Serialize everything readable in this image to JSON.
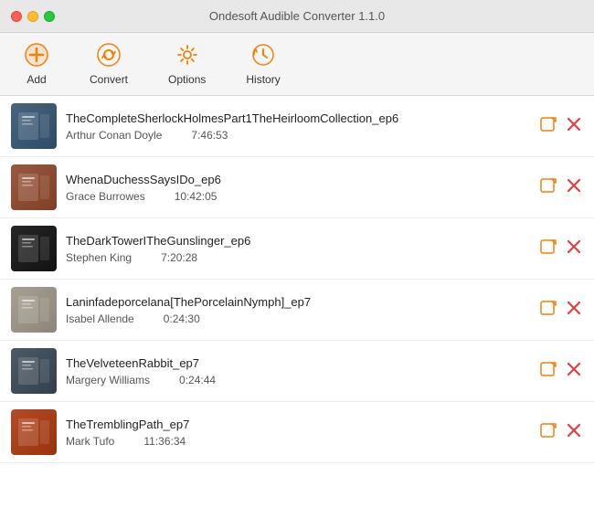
{
  "titleBar": {
    "title": "Ondesoft Audible Converter 1.1.0"
  },
  "toolbar": {
    "items": [
      {
        "id": "add",
        "label": "Add",
        "icon": "add"
      },
      {
        "id": "convert",
        "label": "Convert",
        "icon": "convert"
      },
      {
        "id": "options",
        "label": "Options",
        "icon": "options"
      },
      {
        "id": "history",
        "label": "History",
        "icon": "history"
      }
    ]
  },
  "books": [
    {
      "id": 1,
      "title": "TheCompleteSherlockHolmesPart1TheHeirloomCollection_ep6",
      "author": "Arthur Conan Doyle",
      "duration": "7:46:53",
      "coverClass": "cover-1"
    },
    {
      "id": 2,
      "title": "WhenaDuchessSaysIDo_ep6",
      "author": "Grace Burrowes",
      "duration": "10:42:05",
      "coverClass": "cover-2"
    },
    {
      "id": 3,
      "title": "TheDarkTowerITheGunslinger_ep6",
      "author": "Stephen King",
      "duration": "7:20:28",
      "coverClass": "cover-3"
    },
    {
      "id": 4,
      "title": "Laninfadeporcelana[ThePorcelainNymph]_ep7",
      "author": "Isabel Allende",
      "duration": "0:24:30",
      "coverClass": "cover-4"
    },
    {
      "id": 5,
      "title": "TheVelveteenRabbit_ep7",
      "author": "Margery Williams",
      "duration": "0:24:44",
      "coverClass": "cover-5"
    },
    {
      "id": 6,
      "title": "TheTremblingPath_ep7",
      "author": "Mark Tufo",
      "duration": "11:36:34",
      "coverClass": "cover-6"
    }
  ]
}
